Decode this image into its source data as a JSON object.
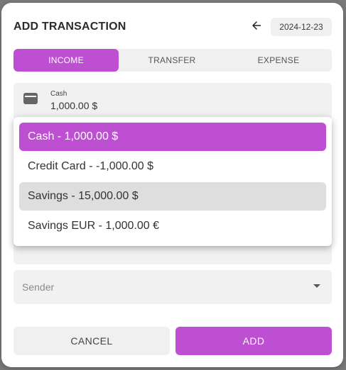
{
  "dialog": {
    "title": "ADD TRANSACTION",
    "date": "2024-12-23"
  },
  "tabs": [
    {
      "label": "INCOME",
      "active": true
    },
    {
      "label": "TRANSFER",
      "active": false
    },
    {
      "label": "EXPENSE",
      "active": false
    }
  ],
  "account": {
    "label": "Cash",
    "value": "1,000.00 $",
    "icon": "wallet-icon"
  },
  "menu": {
    "items": [
      {
        "label": "Cash - 1,000.00 $",
        "state": "selected"
      },
      {
        "label": "Credit Card - -1,000.00 $",
        "state": "normal"
      },
      {
        "label": "Savings - 15,000.00 $",
        "state": "hover"
      },
      {
        "label": "Savings EUR - 1,000.00 €",
        "state": "normal"
      }
    ]
  },
  "sender": {
    "placeholder": "Sender"
  },
  "actions": {
    "cancel_label": "CANCEL",
    "add_label": "ADD"
  },
  "colors": {
    "accent": "#be4fd3",
    "surface": "#f0f0f0",
    "hover": "#dedede"
  }
}
